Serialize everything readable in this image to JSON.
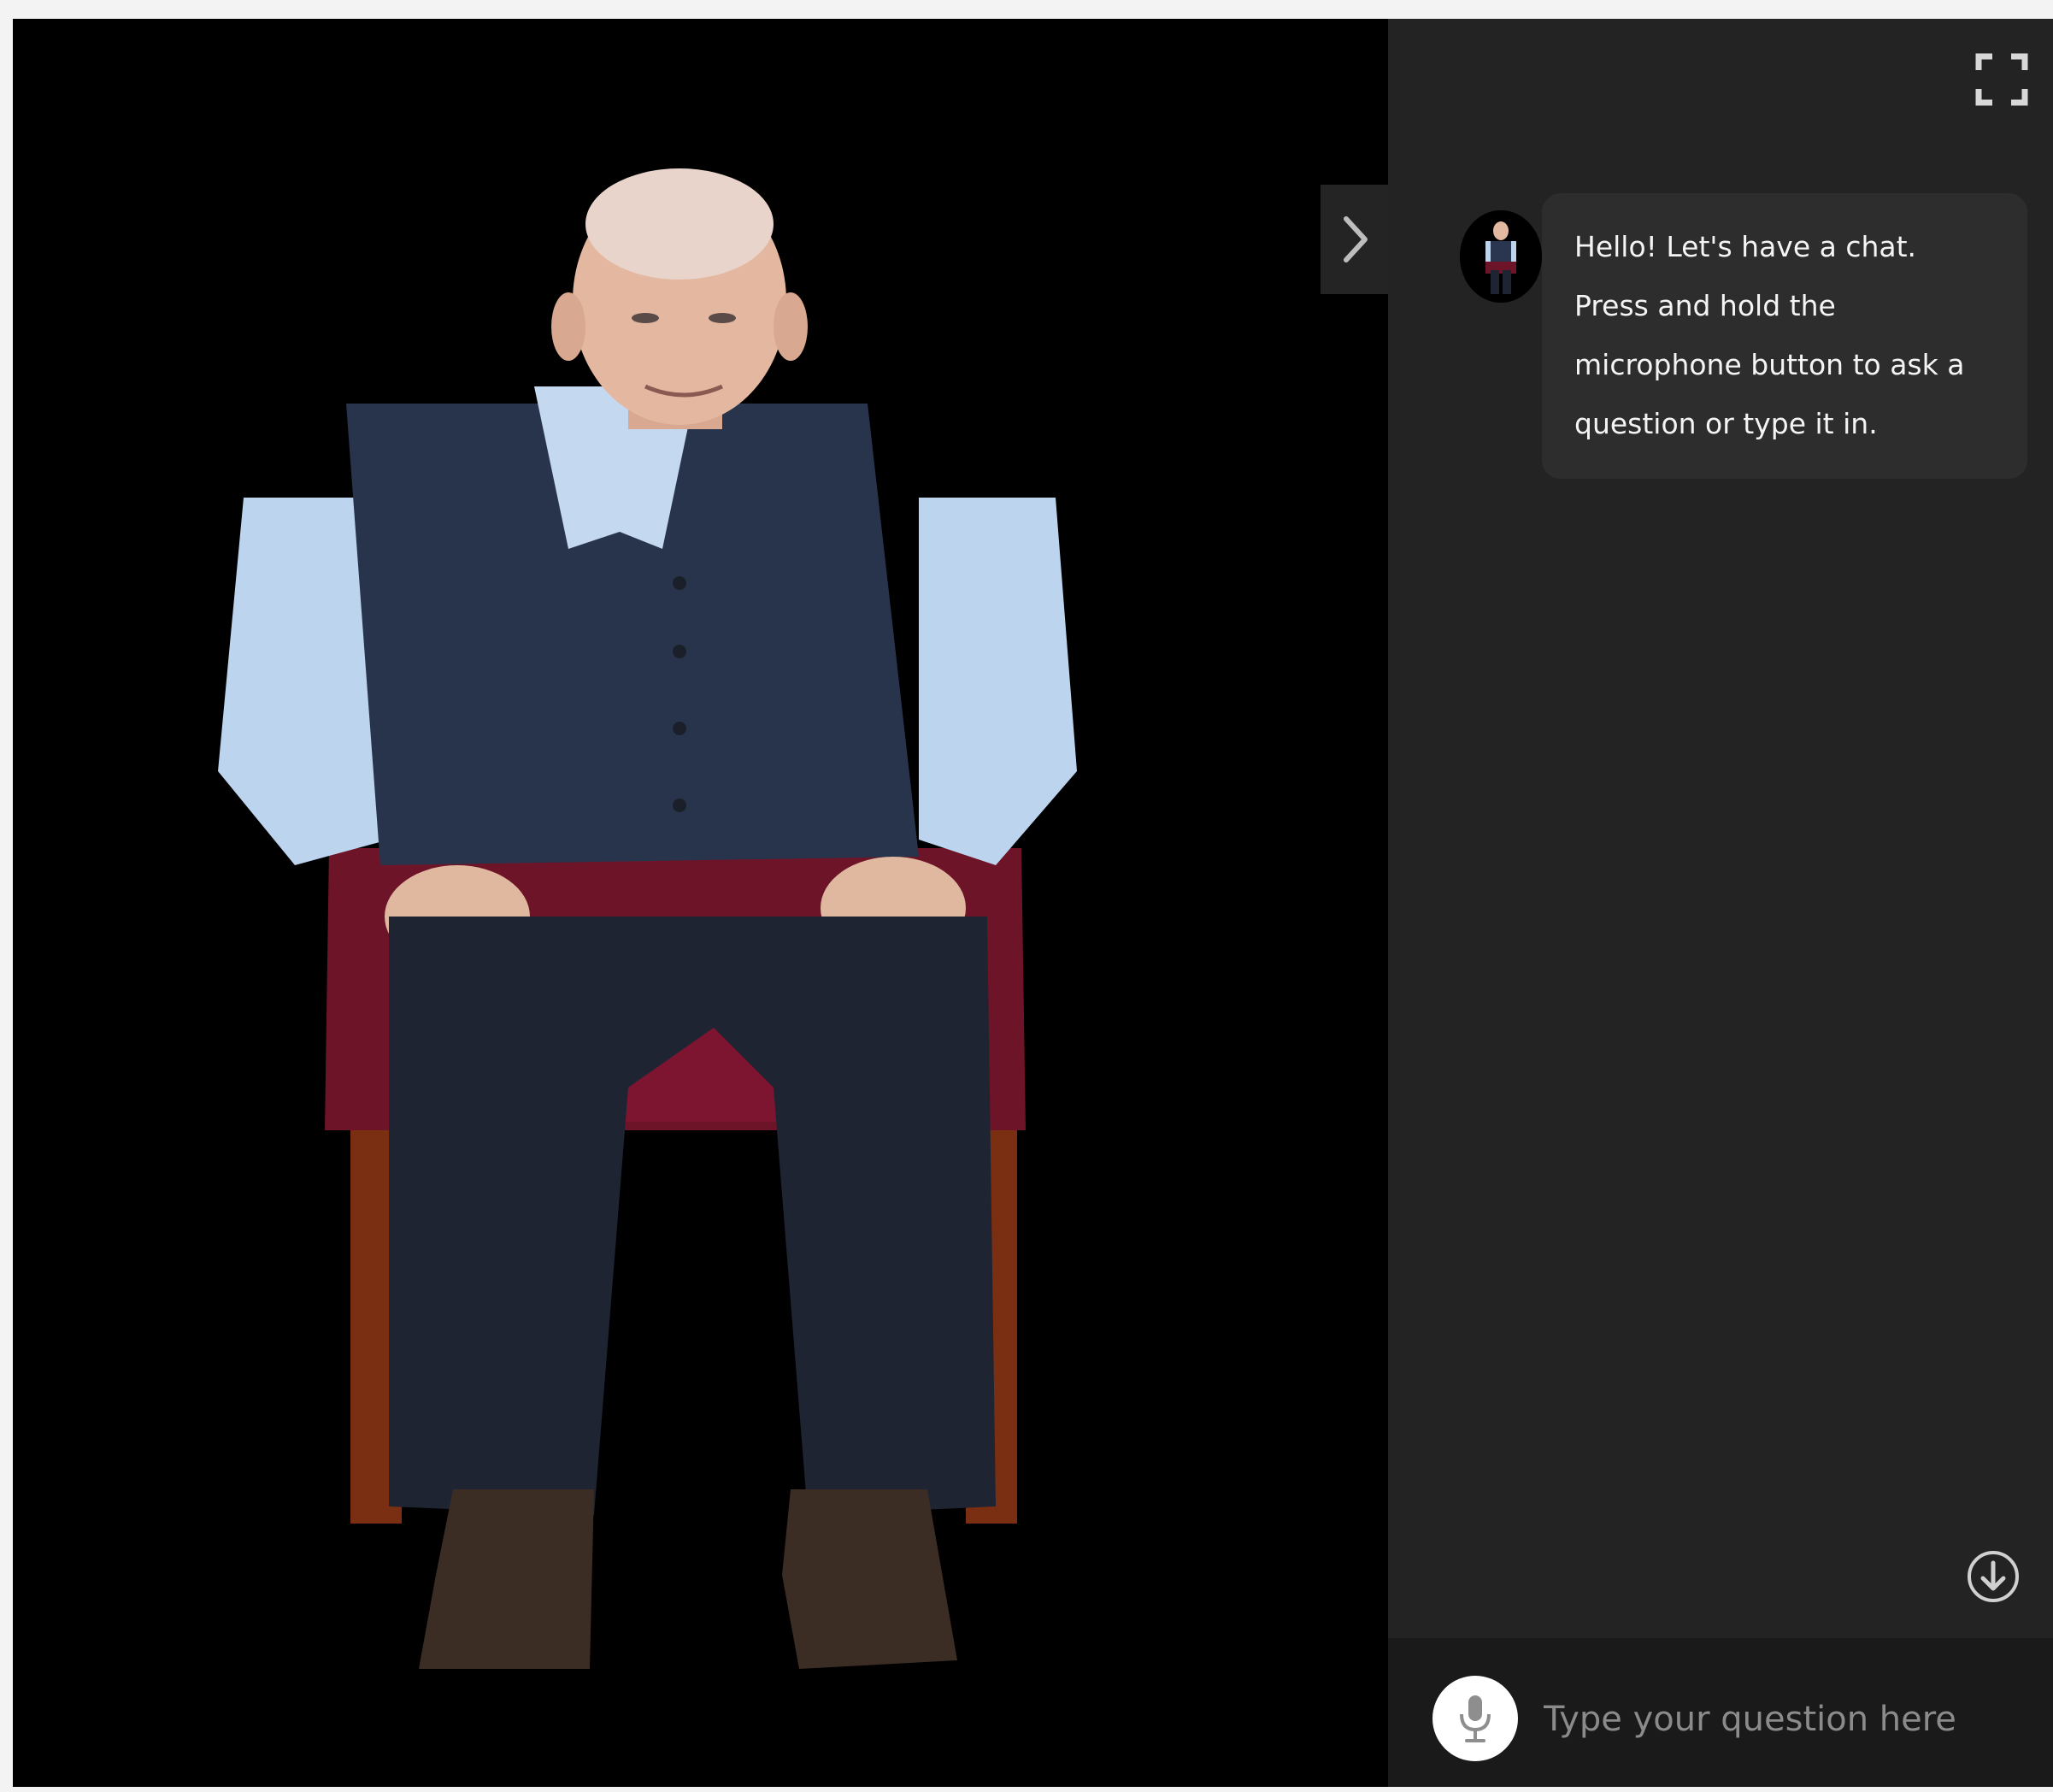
{
  "chat": {
    "messages": [
      {
        "sender": "avatar",
        "text": "Hello! Let's have a chat. Press and hold the microphone button to ask a question or type it in."
      }
    ]
  },
  "input": {
    "placeholder": "Type your question here",
    "value": ""
  },
  "icons": {
    "collapse": "chevron-right-icon",
    "fullscreen": "fullscreen-icon",
    "scroll_down": "arrow-down-circle-icon",
    "mic": "microphone-icon"
  },
  "colors": {
    "video_background": "#000000",
    "panel_background": "#232323",
    "bubble_background": "#2d2d2d",
    "input_bar_background": "#1a1a1a",
    "bubble_text": "#f4f4f4",
    "placeholder_text": "#8b8b8b"
  }
}
